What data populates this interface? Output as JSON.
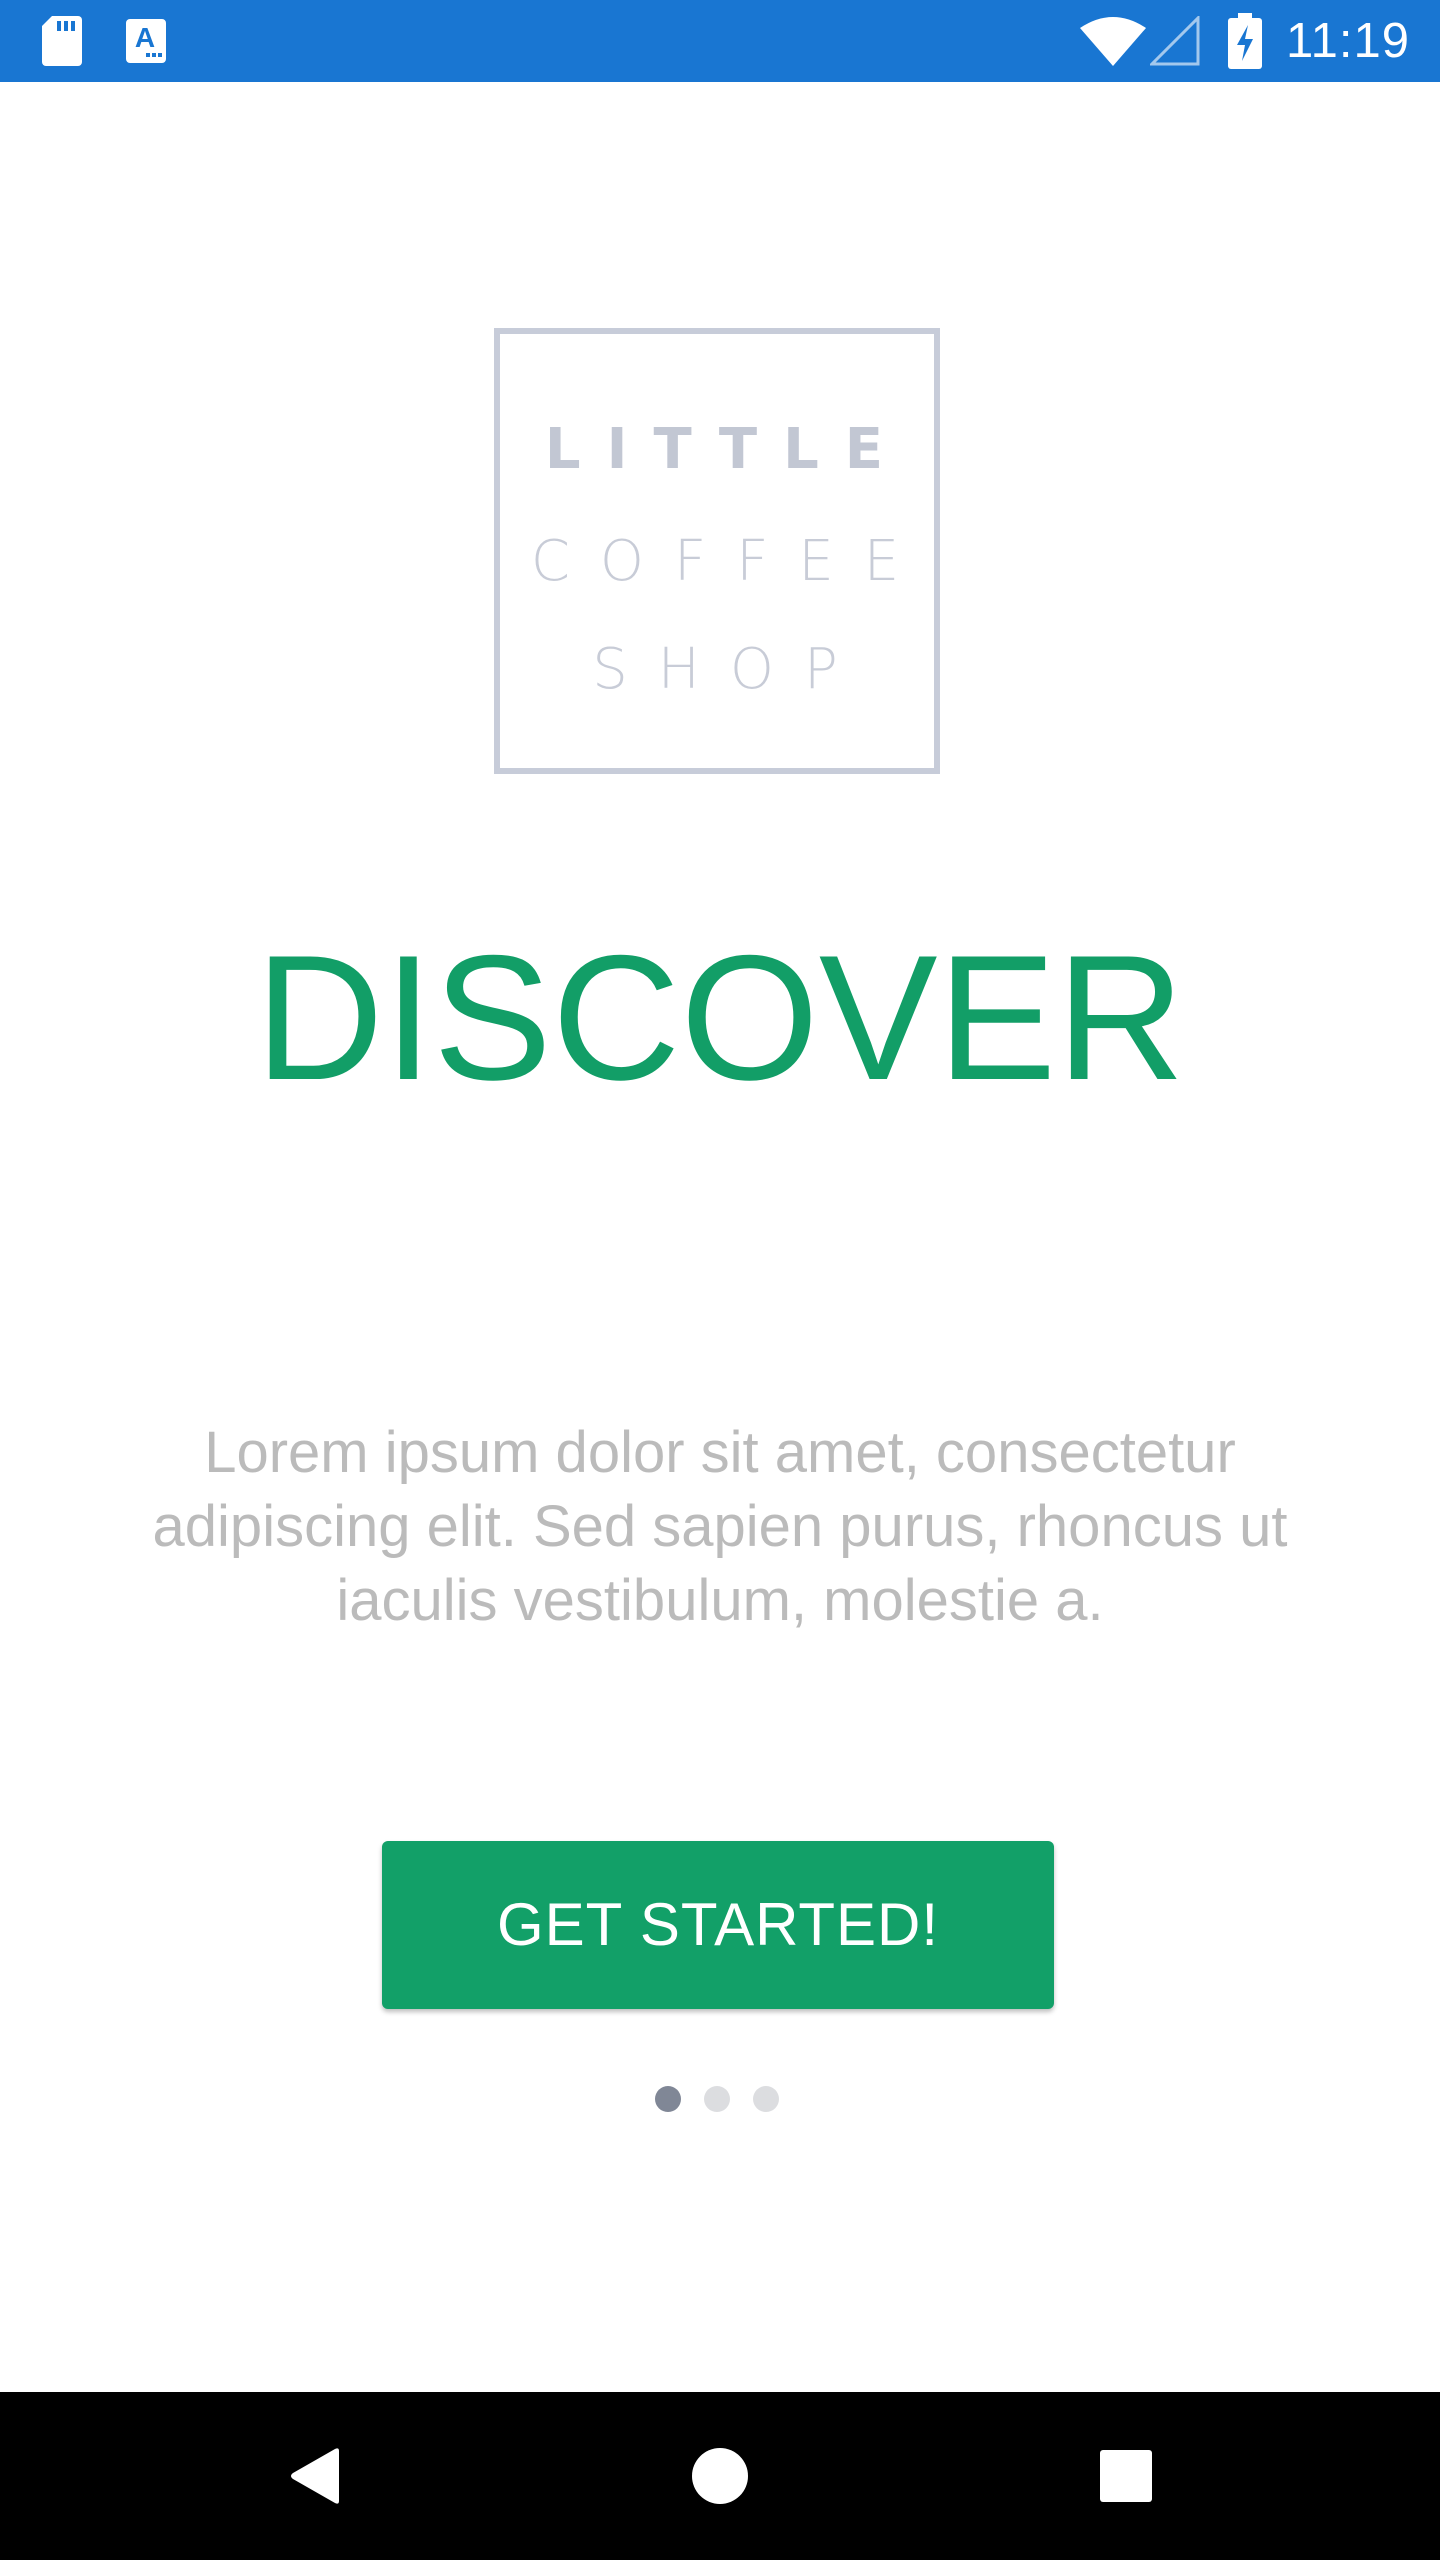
{
  "status_bar": {
    "time": "11:19",
    "background_color": "#1976d2",
    "icons": [
      "sd-card-icon",
      "a-text-icon",
      "wifi-icon",
      "cellular-signal-icon",
      "battery-charging-icon"
    ]
  },
  "logo": {
    "line1": "LITTLE",
    "line2": "COFFEE",
    "line3": "SHOP"
  },
  "onboarding": {
    "title": "DISCOVER",
    "description": "Lorem ipsum dolor sit amet, consectetur adipiscing elit. Sed sapien purus, rhoncus ut iaculis vestibulum, molestie a.",
    "cta_label": "GET STARTED!",
    "accent_color": "#129e67",
    "page_indicator": {
      "total": 3,
      "current": 1
    }
  },
  "nav_bar": {
    "icons": [
      "back-icon",
      "home-icon",
      "recents-icon"
    ]
  }
}
